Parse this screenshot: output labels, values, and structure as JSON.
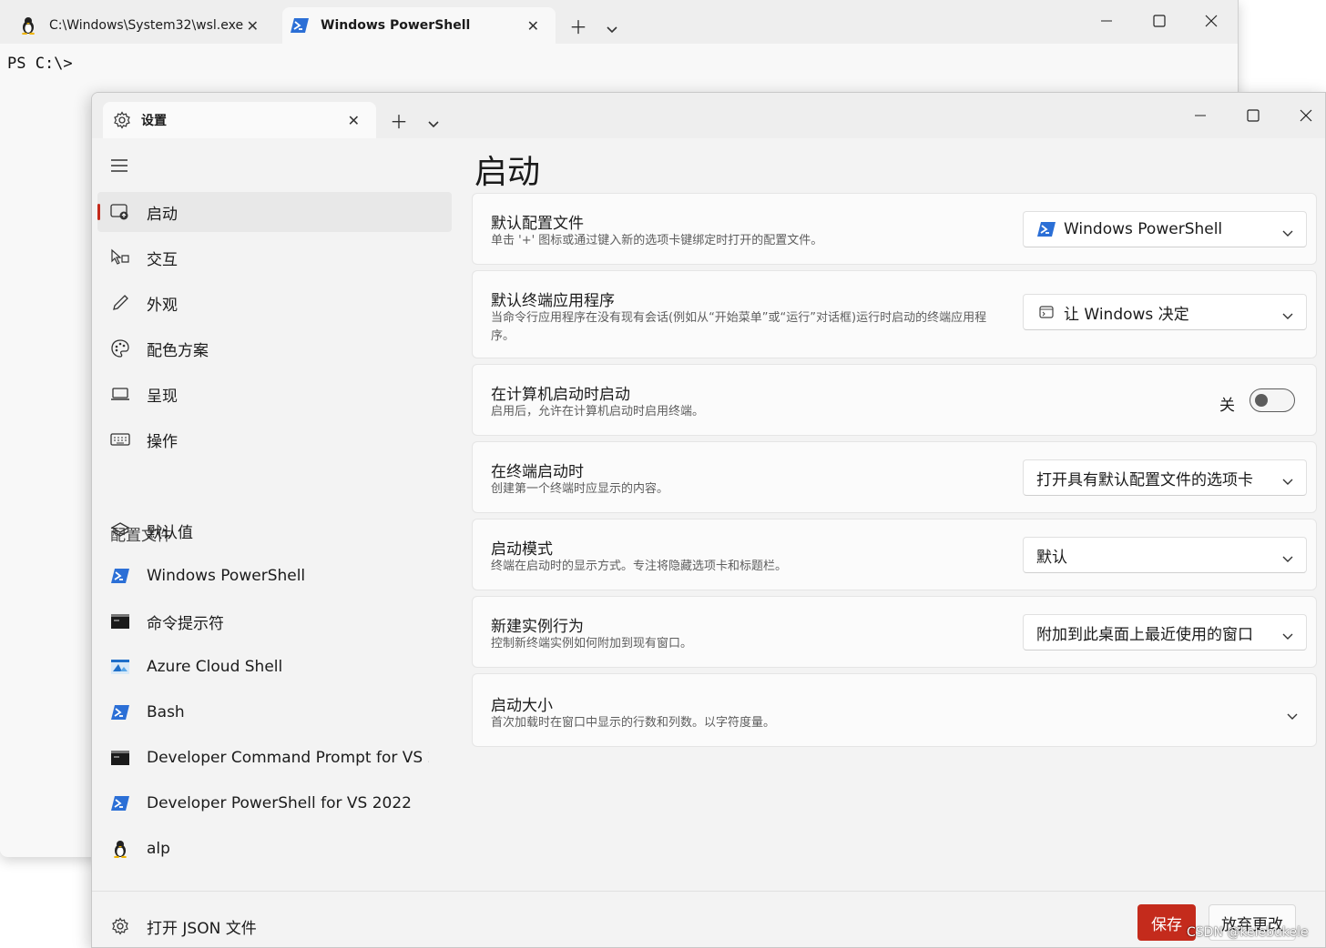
{
  "background_window": {
    "tabs": [
      {
        "label": "C:\\Windows\\System32\\wsl.exe",
        "icon": "linux-penguin-icon"
      },
      {
        "label": "Windows PowerShell",
        "icon": "powershell-icon"
      }
    ],
    "prompt": "PS C:\\>"
  },
  "settings_window": {
    "tab_label": "设置",
    "sidebar": {
      "items": [
        {
          "label": "启动",
          "icon": "startup-icon",
          "active": true
        },
        {
          "label": "交互",
          "icon": "interaction-icon"
        },
        {
          "label": "外观",
          "icon": "pen-icon"
        },
        {
          "label": "配色方案",
          "icon": "palette-icon"
        },
        {
          "label": "呈现",
          "icon": "laptop-icon"
        },
        {
          "label": "操作",
          "icon": "keyboard-icon"
        }
      ],
      "profiles_header": "配置文件",
      "profiles": [
        {
          "label": "默认值",
          "icon": "layers-icon"
        },
        {
          "label": "Windows PowerShell",
          "icon": "powershell-icon"
        },
        {
          "label": "命令提示符",
          "icon": "cmd-icon"
        },
        {
          "label": "Azure Cloud Shell",
          "icon": "azure-icon"
        },
        {
          "label": "Bash",
          "icon": "powershell-icon"
        },
        {
          "label": "Developer Command Prompt for VS 2022",
          "icon": "cmd-icon"
        },
        {
          "label": "Developer PowerShell for VS 2022",
          "icon": "powershell-icon"
        },
        {
          "label": "alp",
          "icon": "linux-penguin-icon"
        }
      ],
      "open_json": "打开 JSON 文件"
    },
    "page_title": "启动",
    "settings": [
      {
        "title": "默认配置文件",
        "description": "单击 '+' 图标或通过键入新的选项卡键绑定时打开的配置文件。",
        "control": "dropdown",
        "value": "Windows PowerShell",
        "icon": "powershell-icon"
      },
      {
        "title": "默认终端应用程序",
        "description": "当命令行应用程序在没有现有会话(例如从“开始菜单”或“运行”对话框)运行时启动的终端应用程序。",
        "control": "dropdown",
        "value": "让 Windows 决定",
        "icon": "terminal-window-icon"
      },
      {
        "title": "在计算机启动时启动",
        "description": "启用后，允许在计算机启动时启用终端。",
        "control": "toggle",
        "toggle_label": "关",
        "on": false
      },
      {
        "title": "在终端启动时",
        "description": "创建第一个终端时应显示的内容。",
        "control": "dropdown",
        "value": "打开具有默认配置文件的选项卡"
      },
      {
        "title": "启动模式",
        "description": "终端在启动时的显示方式。专注将隐藏选项卡和标题栏。",
        "control": "dropdown",
        "value": "默认"
      },
      {
        "title": "新建实例行为",
        "description": "控制新终端实例如何附加到现有窗口。",
        "control": "dropdown",
        "value": "附加到此桌面上最近使用的窗口"
      },
      {
        "title": "启动大小",
        "description": "首次加载时在窗口中显示的行数和列数。以字符度量。",
        "control": "expander"
      }
    ],
    "footer": {
      "save": "保存",
      "discard": "放弃更改"
    }
  },
  "watermark": "CSDN @kelebukele",
  "colors": {
    "accent": "#c42b1c",
    "powershell_blue": "#2b6fd6"
  }
}
